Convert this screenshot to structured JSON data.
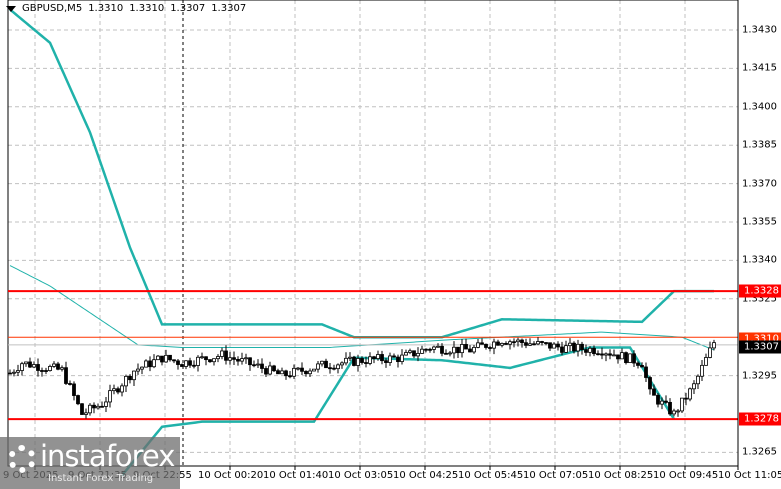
{
  "header": {
    "symbol": "GBPUSD,M5",
    "open": "1.3310",
    "high": "1.3310",
    "low": "1.3307",
    "close": "1.3307"
  },
  "price_axis": [
    "1.3430",
    "1.3415",
    "1.3400",
    "1.3385",
    "1.3370",
    "1.3355",
    "1.3340",
    "1.3325",
    "1.3295",
    "1.3265"
  ],
  "tags": {
    "resistance": "1.3328",
    "ask": "1.3310",
    "bid": "1.3307",
    "support": "1.3278"
  },
  "time_axis": [
    "9 Oct 2025",
    "9 Oct 21:35",
    "9 Oct 22:55",
    "10 Oct 00:20",
    "10 Oct 01:40",
    "10 Oct 03:05",
    "10 Oct 04:25",
    "10 Oct 05:45",
    "10 Oct 07:05",
    "10 Oct 08:25",
    "10 Oct 09:45",
    "10 Oct 11:05"
  ],
  "logo": {
    "name": "instaforex",
    "tagline": "Instant Forex Trading"
  },
  "colors": {
    "band": "#20b2aa",
    "level": "#ff0000",
    "ask": "#ff3300",
    "bid": "#c0c0c0"
  },
  "chart_data": {
    "type": "candlestick",
    "symbol": "GBPUSD",
    "timeframe": "M5",
    "ylim": [
      1.3261,
      1.3442
    ],
    "levels": [
      1.3328,
      1.3278
    ],
    "price_path": [
      [
        0,
        1.3296
      ],
      [
        3,
        1.33
      ],
      [
        13,
        1.3297
      ],
      [
        18,
        1.328
      ],
      [
        23,
        1.3284
      ],
      [
        31,
        1.3297
      ],
      [
        38,
        1.3302
      ],
      [
        43,
        1.33
      ],
      [
        53,
        1.3303
      ],
      [
        63,
        1.3298
      ],
      [
        68,
        1.3295
      ],
      [
        78,
        1.3299
      ],
      [
        88,
        1.3301
      ],
      [
        98,
        1.3302
      ],
      [
        105,
        1.3306
      ],
      [
        115,
        1.3305
      ],
      [
        123,
        1.3309
      ],
      [
        138,
        1.3306
      ],
      [
        148,
        1.3305
      ],
      [
        158,
        1.33
      ],
      [
        160,
        1.3288
      ],
      [
        166,
        1.328
      ],
      [
        171,
        1.3291
      ],
      [
        173,
        1.3298
      ],
      [
        176,
        1.3308
      ]
    ],
    "upper_band": [
      [
        0,
        1.3438
      ],
      [
        10,
        1.3425
      ],
      [
        20,
        1.339
      ],
      [
        30,
        1.3345
      ],
      [
        38,
        1.3315
      ],
      [
        78,
        1.3315
      ],
      [
        86,
        1.331
      ],
      [
        108,
        1.331
      ],
      [
        123,
        1.3317
      ],
      [
        158,
        1.3316
      ],
      [
        166,
        1.3328
      ],
      [
        176,
        1.3328
      ]
    ],
    "middle_band": [
      [
        0,
        1.3338
      ],
      [
        10,
        1.333
      ],
      [
        32,
        1.3307
      ],
      [
        43,
        1.3306
      ],
      [
        80,
        1.3306
      ],
      [
        110,
        1.3309
      ],
      [
        148,
        1.3312
      ],
      [
        168,
        1.331
      ],
      [
        176,
        1.3305
      ]
    ],
    "lower_band": [
      [
        28,
        1.3256
      ],
      [
        38,
        1.3275
      ],
      [
        48,
        1.3277
      ],
      [
        76,
        1.3277
      ],
      [
        86,
        1.3302
      ],
      [
        108,
        1.3301
      ],
      [
        125,
        1.3298
      ],
      [
        145,
        1.3306
      ],
      [
        155,
        1.3306
      ],
      [
        166,
        1.3278
      ]
    ]
  }
}
